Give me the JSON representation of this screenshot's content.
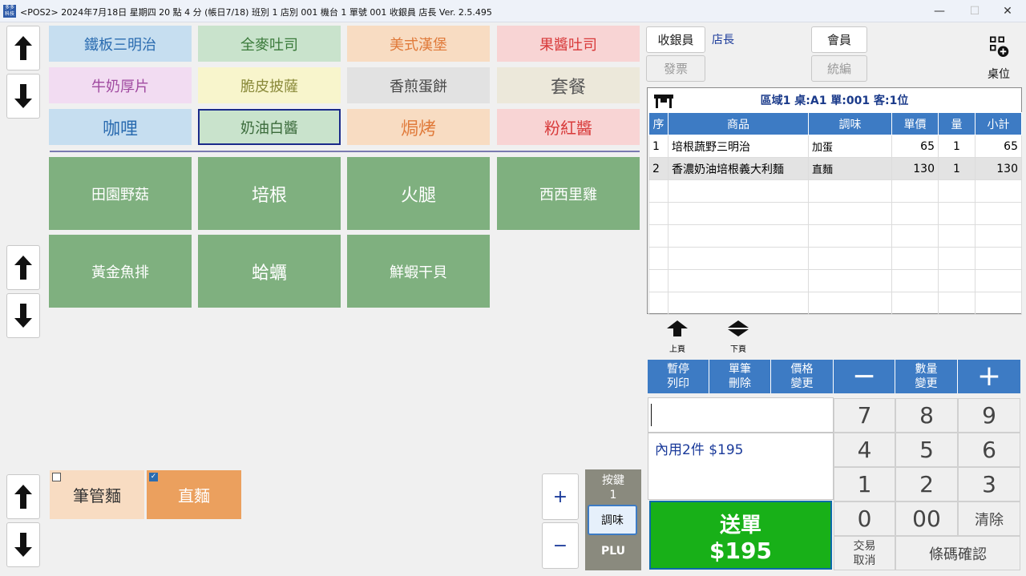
{
  "titlebar": {
    "icon_text": "多多科技",
    "title": "<POS2> 2024年7月18日 星期四 20 點 4 分 (帳日7/18) 班別 1 店別 001 機台 1 單號 001 收銀員 店長  Ver. 2.5.495",
    "minimize": "—",
    "maximize": "☐",
    "close": "✕"
  },
  "categories": [
    {
      "label": "鐵板三明治",
      "bg": "#c6def0",
      "color": "#2b6cb0"
    },
    {
      "label": "全麥吐司",
      "bg": "#c9e3cc",
      "color": "#3a7a3a"
    },
    {
      "label": "美式漢堡",
      "bg": "#f8dcc2",
      "color": "#e07a3a"
    },
    {
      "label": "果醬吐司",
      "bg": "#f8d4d4",
      "color": "#d83a3a"
    },
    {
      "label": "牛奶厚片",
      "bg": "#f2dcf2",
      "color": "#a04aa0"
    },
    {
      "label": "脆皮披薩",
      "bg": "#f8f5cc",
      "color": "#8a8a3a"
    },
    {
      "label": "香煎蛋餅",
      "bg": "#e2e2e2",
      "color": "#444444"
    },
    {
      "label": "套餐",
      "bg": "#ece8da",
      "color": "#555555"
    },
    {
      "label": "咖哩",
      "bg": "#c6def0",
      "color": "#2b6cb0"
    },
    {
      "label": "奶油白醬",
      "bg": "#c9e3cc",
      "color": "#3a6a3a"
    },
    {
      "label": "焗烤",
      "bg": "#f8dcc2",
      "color": "#e07a3a"
    },
    {
      "label": "粉紅醬",
      "bg": "#f8d4d4",
      "color": "#d83a3a"
    }
  ],
  "items": [
    "田園野菇",
    "培根",
    "火腿",
    "西西里雞",
    "黃金魚排",
    "蛤蠣",
    "鮮蝦干貝"
  ],
  "options": [
    {
      "label": "筆管麵",
      "checked": false
    },
    {
      "label": "直麵",
      "checked": true
    }
  ],
  "qty_buttons": {
    "plus": "+",
    "minus": "−"
  },
  "key_panel": {
    "title": "按鍵",
    "count": "1",
    "season": "調味",
    "plu": "PLU"
  },
  "right_top": {
    "cashier_button": "收銀員",
    "cashier_name": "店長",
    "invoice_button": "發票",
    "member_button": "會員",
    "tax_id_button": "統編",
    "table_label": "桌位"
  },
  "order": {
    "header": "區域1  桌:A1  單:001  客:1位",
    "columns": [
      "序",
      "商品",
      "調味",
      "單價",
      "量",
      "小計"
    ],
    "rows": [
      {
        "no": "1",
        "name": "培根蔬野三明治",
        "season": "加蛋",
        "price": "65",
        "qty": "1",
        "subtotal": "65"
      },
      {
        "no": "2",
        "name": "香濃奶油培根義大利麵",
        "season": "直麵",
        "price": "130",
        "qty": "1",
        "subtotal": "130"
      }
    ]
  },
  "paging": {
    "prev": "上頁",
    "next": "下頁"
  },
  "functions": [
    {
      "label": "暫停\n列印"
    },
    {
      "label": "單筆\n刪除"
    },
    {
      "label": "價格\n變更"
    },
    {
      "label": "−"
    },
    {
      "label": "數量\n變更"
    },
    {
      "label": "+"
    }
  ],
  "summary": "內用2件 $195",
  "send": {
    "label": "送單",
    "amount": "$195"
  },
  "keypad": {
    "k7": "7",
    "k8": "8",
    "k9": "9",
    "k4": "4",
    "k5": "5",
    "k6": "6",
    "k1": "1",
    "k2": "2",
    "k3": "3",
    "k0": "0",
    "k00": "00",
    "clear": "清除",
    "cancel": "交易\n取消",
    "barcode": "條碼確認"
  }
}
